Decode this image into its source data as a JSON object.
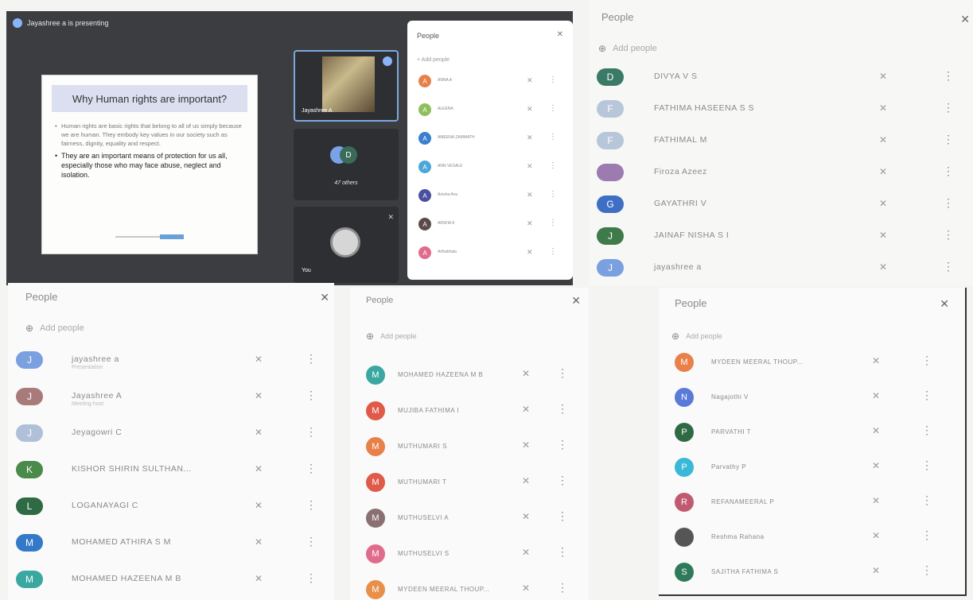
{
  "meeting": {
    "presenting_text": "Jayashree a is presenting",
    "slide": {
      "title": "Why Human rights are important?",
      "bullet1": "Human rights are basic rights that belong to all of us simply because we are human. They embody key values in our society such as fairness, dignity, equality and respect.",
      "bullet2": "They are an important means of protection for us all, especially those who may face abuse, neglect and isolation."
    },
    "speaker_name": "Jayashree A",
    "others_avatar_letter": "D",
    "others_label": "47 others",
    "you_label": "You",
    "mini_people": {
      "title": "People",
      "add": "Add people",
      "rows": [
        {
          "letter": "A",
          "name": "ANNA A",
          "color": "#e8804a"
        },
        {
          "letter": "A",
          "name": "ALEENA",
          "color": "#8fbf5a"
        },
        {
          "letter": "A",
          "name": "AMEENA ZAMMATH",
          "color": "#3a7fd0"
        },
        {
          "letter": "A",
          "name": "ANN VESALE",
          "color": "#4aa7d8"
        },
        {
          "letter": "A",
          "name": "Anisha Anu",
          "color": "#4a4fa0"
        },
        {
          "letter": "A",
          "name": "ARSHA K",
          "color": "#5b4b48"
        },
        {
          "letter": "A",
          "name": "Arthakhala",
          "color": "#e06c8c"
        }
      ]
    }
  },
  "panel_tr": {
    "title": "People",
    "add": "Add people",
    "rows": [
      {
        "letter": "D",
        "name": "DIVYA V S",
        "color": "#3a7a66"
      },
      {
        "letter": "F",
        "name": "FATHIMA HASEENA S S",
        "color": "#b8c6da"
      },
      {
        "letter": "F",
        "name": "FATHIMAL M",
        "color": "#b8c6da"
      },
      {
        "letter": "",
        "name": "Firoza Azeez",
        "color": "#9b7bb0"
      },
      {
        "letter": "G",
        "name": "GAYATHRI V",
        "color": "#3f6fc4"
      },
      {
        "letter": "J",
        "name": "JAINAF NISHA S I",
        "color": "#3f7a4a"
      },
      {
        "letter": "J",
        "name": "jayashree a",
        "color": "#7aa0e0"
      }
    ]
  },
  "panel_bl": {
    "title": "People",
    "add": "Add people",
    "rows": [
      {
        "letter": "J",
        "name": "jayashree a",
        "sub": "Presentation",
        "color": "#7aa0e0"
      },
      {
        "letter": "J",
        "name": "Jayashree A",
        "sub": "Meeting host",
        "color": "#a97a7a"
      },
      {
        "letter": "J",
        "name": "Jeyagowri C",
        "sub": "",
        "color": "#b0c0d8"
      },
      {
        "letter": "K",
        "name": "KISHOR SHIRIN SULTHAN...",
        "sub": "",
        "color": "#4a8a4a"
      },
      {
        "letter": "L",
        "name": "LOGANAYAGI C",
        "sub": "",
        "color": "#2f6a44"
      },
      {
        "letter": "M",
        "name": "MOHAMED ATHIRA S M",
        "sub": "",
        "color": "#3478c8"
      },
      {
        "letter": "M",
        "name": "MOHAMED HAZEENA M B",
        "sub": "",
        "color": "#3aa8a0"
      }
    ]
  },
  "panel_bm": {
    "title": "People",
    "add": "Add people",
    "rows": [
      {
        "letter": "M",
        "name": "MOHAMED HAZEENA M B",
        "color": "#3aa8a0"
      },
      {
        "letter": "M",
        "name": "MUJIBA FATHIMA I",
        "color": "#e05a4a"
      },
      {
        "letter": "M",
        "name": "MUTHUMARI S",
        "color": "#e8804a"
      },
      {
        "letter": "M",
        "name": "MUTHUMARI T",
        "color": "#e05a4a"
      },
      {
        "letter": "M",
        "name": "MUTHUSELVI A",
        "color": "#8a7070"
      },
      {
        "letter": "M",
        "name": "MUTHUSELVI S",
        "color": "#e06c8c"
      },
      {
        "letter": "M",
        "name": "MYDEEN MEERAL THOUP...",
        "color": "#e8904a"
      }
    ]
  },
  "panel_br": {
    "title": "People",
    "add": "Add people",
    "rows": [
      {
        "letter": "M",
        "name": "MYDEEN MEERAL THOUP...",
        "color": "#e8804a"
      },
      {
        "letter": "N",
        "name": "Nagajothi V",
        "color": "#5a7ad8"
      },
      {
        "letter": "P",
        "name": "PARVATHI T",
        "color": "#2f6a44"
      },
      {
        "letter": "P",
        "name": "Parvathy P",
        "color": "#3ab8d8"
      },
      {
        "letter": "R",
        "name": "REFANAMEERAL P",
        "color": "#c05a70"
      },
      {
        "letter": "",
        "name": "Reshma Rahana",
        "color": "#555"
      },
      {
        "letter": "S",
        "name": "SAJITHA FATHIMA S",
        "color": "#2f7a5a"
      }
    ]
  }
}
